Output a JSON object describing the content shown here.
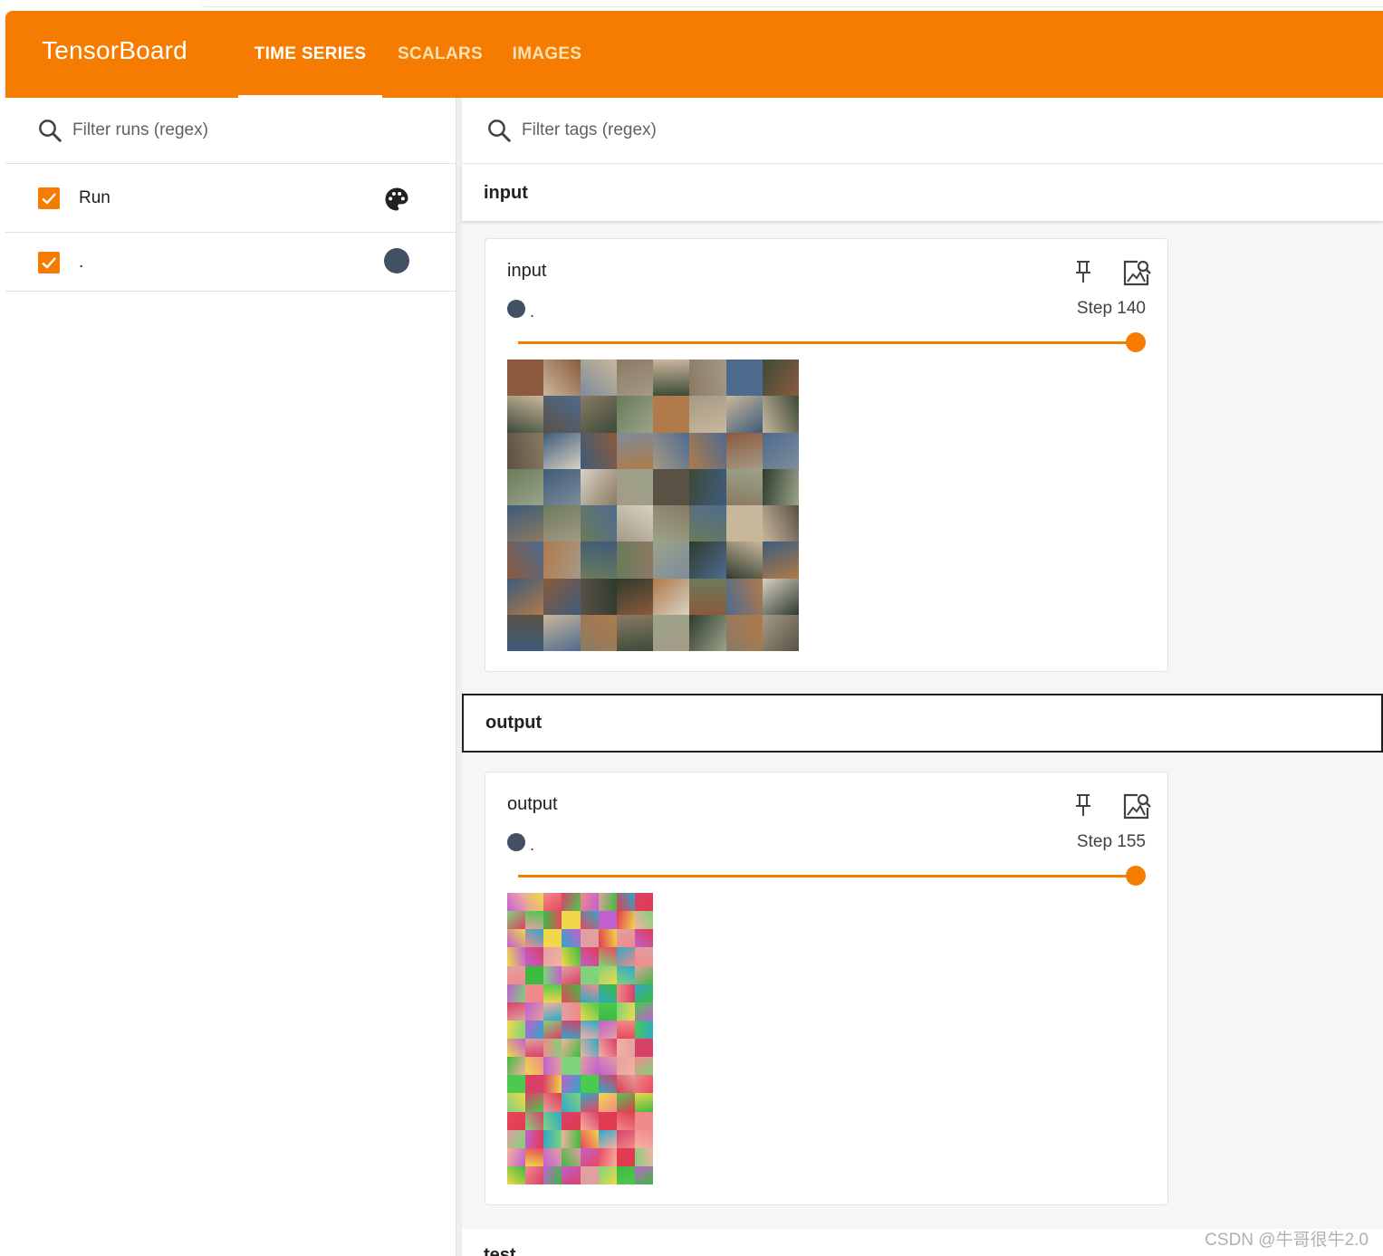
{
  "app": {
    "title": "TensorBoard"
  },
  "tabs": [
    {
      "label": "TIME SERIES",
      "active": true
    },
    {
      "label": "SCALARS",
      "active": false
    },
    {
      "label": "IMAGES",
      "active": false
    }
  ],
  "sidebar": {
    "filter_placeholder": "Filter runs (regex)",
    "runs": [
      {
        "label": "Run",
        "checked": true,
        "icon": "palette-icon"
      },
      {
        "label": ".",
        "checked": true,
        "color": "#425066"
      }
    ]
  },
  "main": {
    "filter_placeholder": "Filter tags (regex)",
    "groups": [
      {
        "name": "input",
        "card": {
          "title": "input",
          "run_label": ".",
          "step_label": "Step 140",
          "slider_fraction": 1.0
        }
      },
      {
        "name": "output",
        "card": {
          "title": "output",
          "run_label": ".",
          "step_label": "Step 155",
          "slider_fraction": 1.0
        }
      }
    ],
    "next_group_partial": "test"
  },
  "colors": {
    "accent": "#f57c00",
    "run_color": "#425066"
  },
  "watermark": "CSDN @牛哥很牛2.0"
}
